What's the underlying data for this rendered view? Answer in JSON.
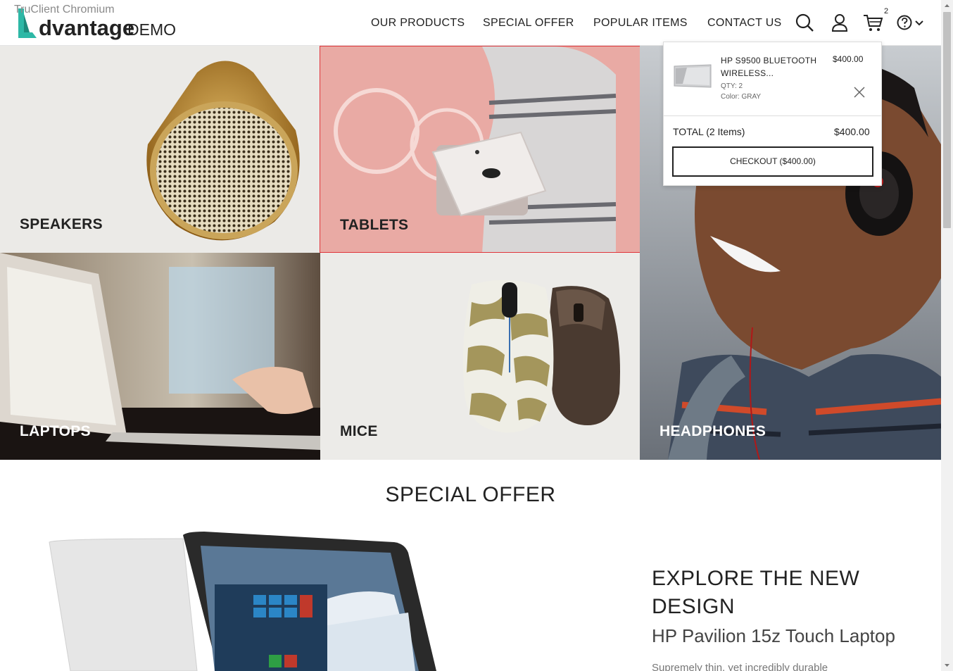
{
  "window": {
    "title": "TruClient Chromium"
  },
  "logo": {
    "name": "dvantage",
    "suffix": "DEMO"
  },
  "nav": {
    "items": [
      {
        "label": "OUR PRODUCTS"
      },
      {
        "label": "SPECIAL OFFER"
      },
      {
        "label": "POPULAR ITEMS"
      },
      {
        "label": "CONTACT US"
      }
    ],
    "icons": [
      "search-icon",
      "user-icon",
      "cart-icon",
      "help-icon",
      "chevron-down-icon"
    ],
    "cart_count": "2"
  },
  "categories": {
    "speakers": "SPEAKERS",
    "tablets": "TABLETS",
    "laptops": "LAPTOPS",
    "mice": "MICE",
    "headphones": "HEADPHONES"
  },
  "cart_popup": {
    "item": {
      "name": "HP S9500 BLUETOOTH WIRELESS...",
      "price": "$400.00",
      "qty": "QTY: 2",
      "color": "Color: GRAY"
    },
    "total_label": "TOTAL (2 Items)",
    "total_value": "$400.00",
    "checkout_label": "CHECKOUT ($400.00)"
  },
  "special_offer": {
    "heading": "SPECIAL OFFER",
    "title": "EXPLORE THE NEW DESIGN",
    "subtitle": "HP Pavilion 15z Touch Laptop",
    "description": "Supremely thin, yet incredibly durable"
  },
  "colors": {
    "accent": "#2db8a6",
    "selected_border": "#e0343a"
  }
}
